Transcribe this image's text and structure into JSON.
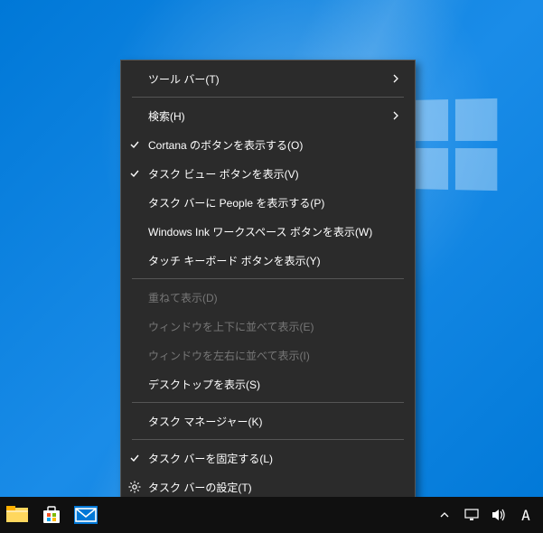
{
  "context_menu": {
    "items": [
      {
        "label": "ツール バー(T)",
        "enabled": true,
        "checked": false,
        "submenu": true,
        "icon": null
      },
      {
        "sep": true
      },
      {
        "label": "検索(H)",
        "enabled": true,
        "checked": false,
        "submenu": true,
        "icon": null
      },
      {
        "label": "Cortana のボタンを表示する(O)",
        "enabled": true,
        "checked": true,
        "submenu": false,
        "icon": null
      },
      {
        "label": "タスク ビュー ボタンを表示(V)",
        "enabled": true,
        "checked": true,
        "submenu": false,
        "icon": null
      },
      {
        "label": "タスク バーに People を表示する(P)",
        "enabled": true,
        "checked": false,
        "submenu": false,
        "icon": null
      },
      {
        "label": "Windows Ink ワークスペース ボタンを表示(W)",
        "enabled": true,
        "checked": false,
        "submenu": false,
        "icon": null
      },
      {
        "label": "タッチ キーボード ボタンを表示(Y)",
        "enabled": true,
        "checked": false,
        "submenu": false,
        "icon": null
      },
      {
        "sep": true
      },
      {
        "label": "重ねて表示(D)",
        "enabled": false,
        "checked": false,
        "submenu": false,
        "icon": null
      },
      {
        "label": "ウィンドウを上下に並べて表示(E)",
        "enabled": false,
        "checked": false,
        "submenu": false,
        "icon": null
      },
      {
        "label": "ウィンドウを左右に並べて表示(I)",
        "enabled": false,
        "checked": false,
        "submenu": false,
        "icon": null
      },
      {
        "label": "デスクトップを表示(S)",
        "enabled": true,
        "checked": false,
        "submenu": false,
        "icon": null
      },
      {
        "sep": true
      },
      {
        "label": "タスク マネージャー(K)",
        "enabled": true,
        "checked": false,
        "submenu": false,
        "icon": null
      },
      {
        "sep": true
      },
      {
        "label": "タスク バーを固定する(L)",
        "enabled": true,
        "checked": true,
        "submenu": false,
        "icon": null
      },
      {
        "label": "タスク バーの設定(T)",
        "enabled": true,
        "checked": false,
        "submenu": false,
        "icon": "gear"
      }
    ]
  },
  "taskbar": {
    "apps": [
      {
        "name": "file-explorer"
      },
      {
        "name": "microsoft-store"
      },
      {
        "name": "mail"
      }
    ]
  },
  "tray": {
    "ime_text": "A"
  }
}
